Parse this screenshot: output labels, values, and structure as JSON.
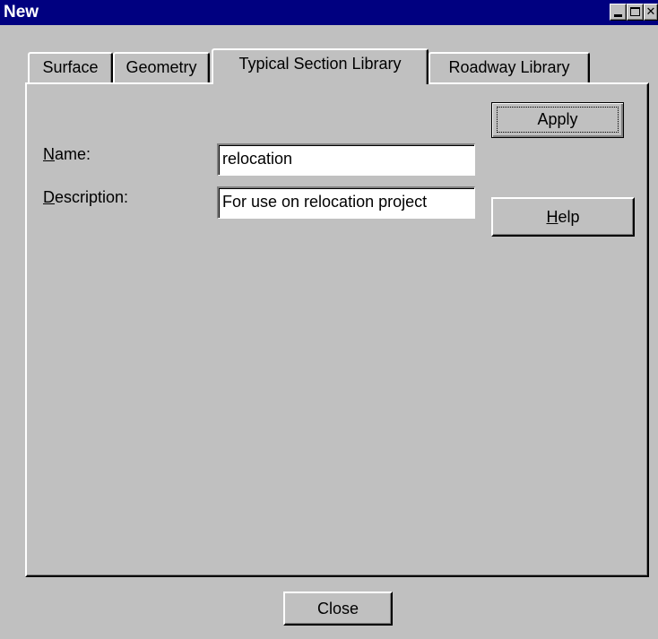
{
  "window": {
    "title": "New",
    "controls": {
      "minimize": "minimize-icon",
      "maximize": "maximize-icon",
      "close": "close-icon"
    }
  },
  "tabs": [
    {
      "label": "Surface",
      "active": false
    },
    {
      "label": "Geometry",
      "active": false
    },
    {
      "label": "Typical Section Library",
      "active": true
    },
    {
      "label": "Roadway Library",
      "active": false
    }
  ],
  "form": {
    "name": {
      "label_mnemonic": "N",
      "label_rest": "ame:",
      "value": "relocation"
    },
    "description": {
      "label_mnemonic": "D",
      "label_rest": "escription:",
      "value": "For use on relocation project"
    }
  },
  "buttons": {
    "apply": "Apply",
    "help_mnemonic": "H",
    "help_rest": "elp",
    "close": "Close"
  },
  "colors": {
    "title_bar": "#000080",
    "face": "#c0c0c0"
  }
}
